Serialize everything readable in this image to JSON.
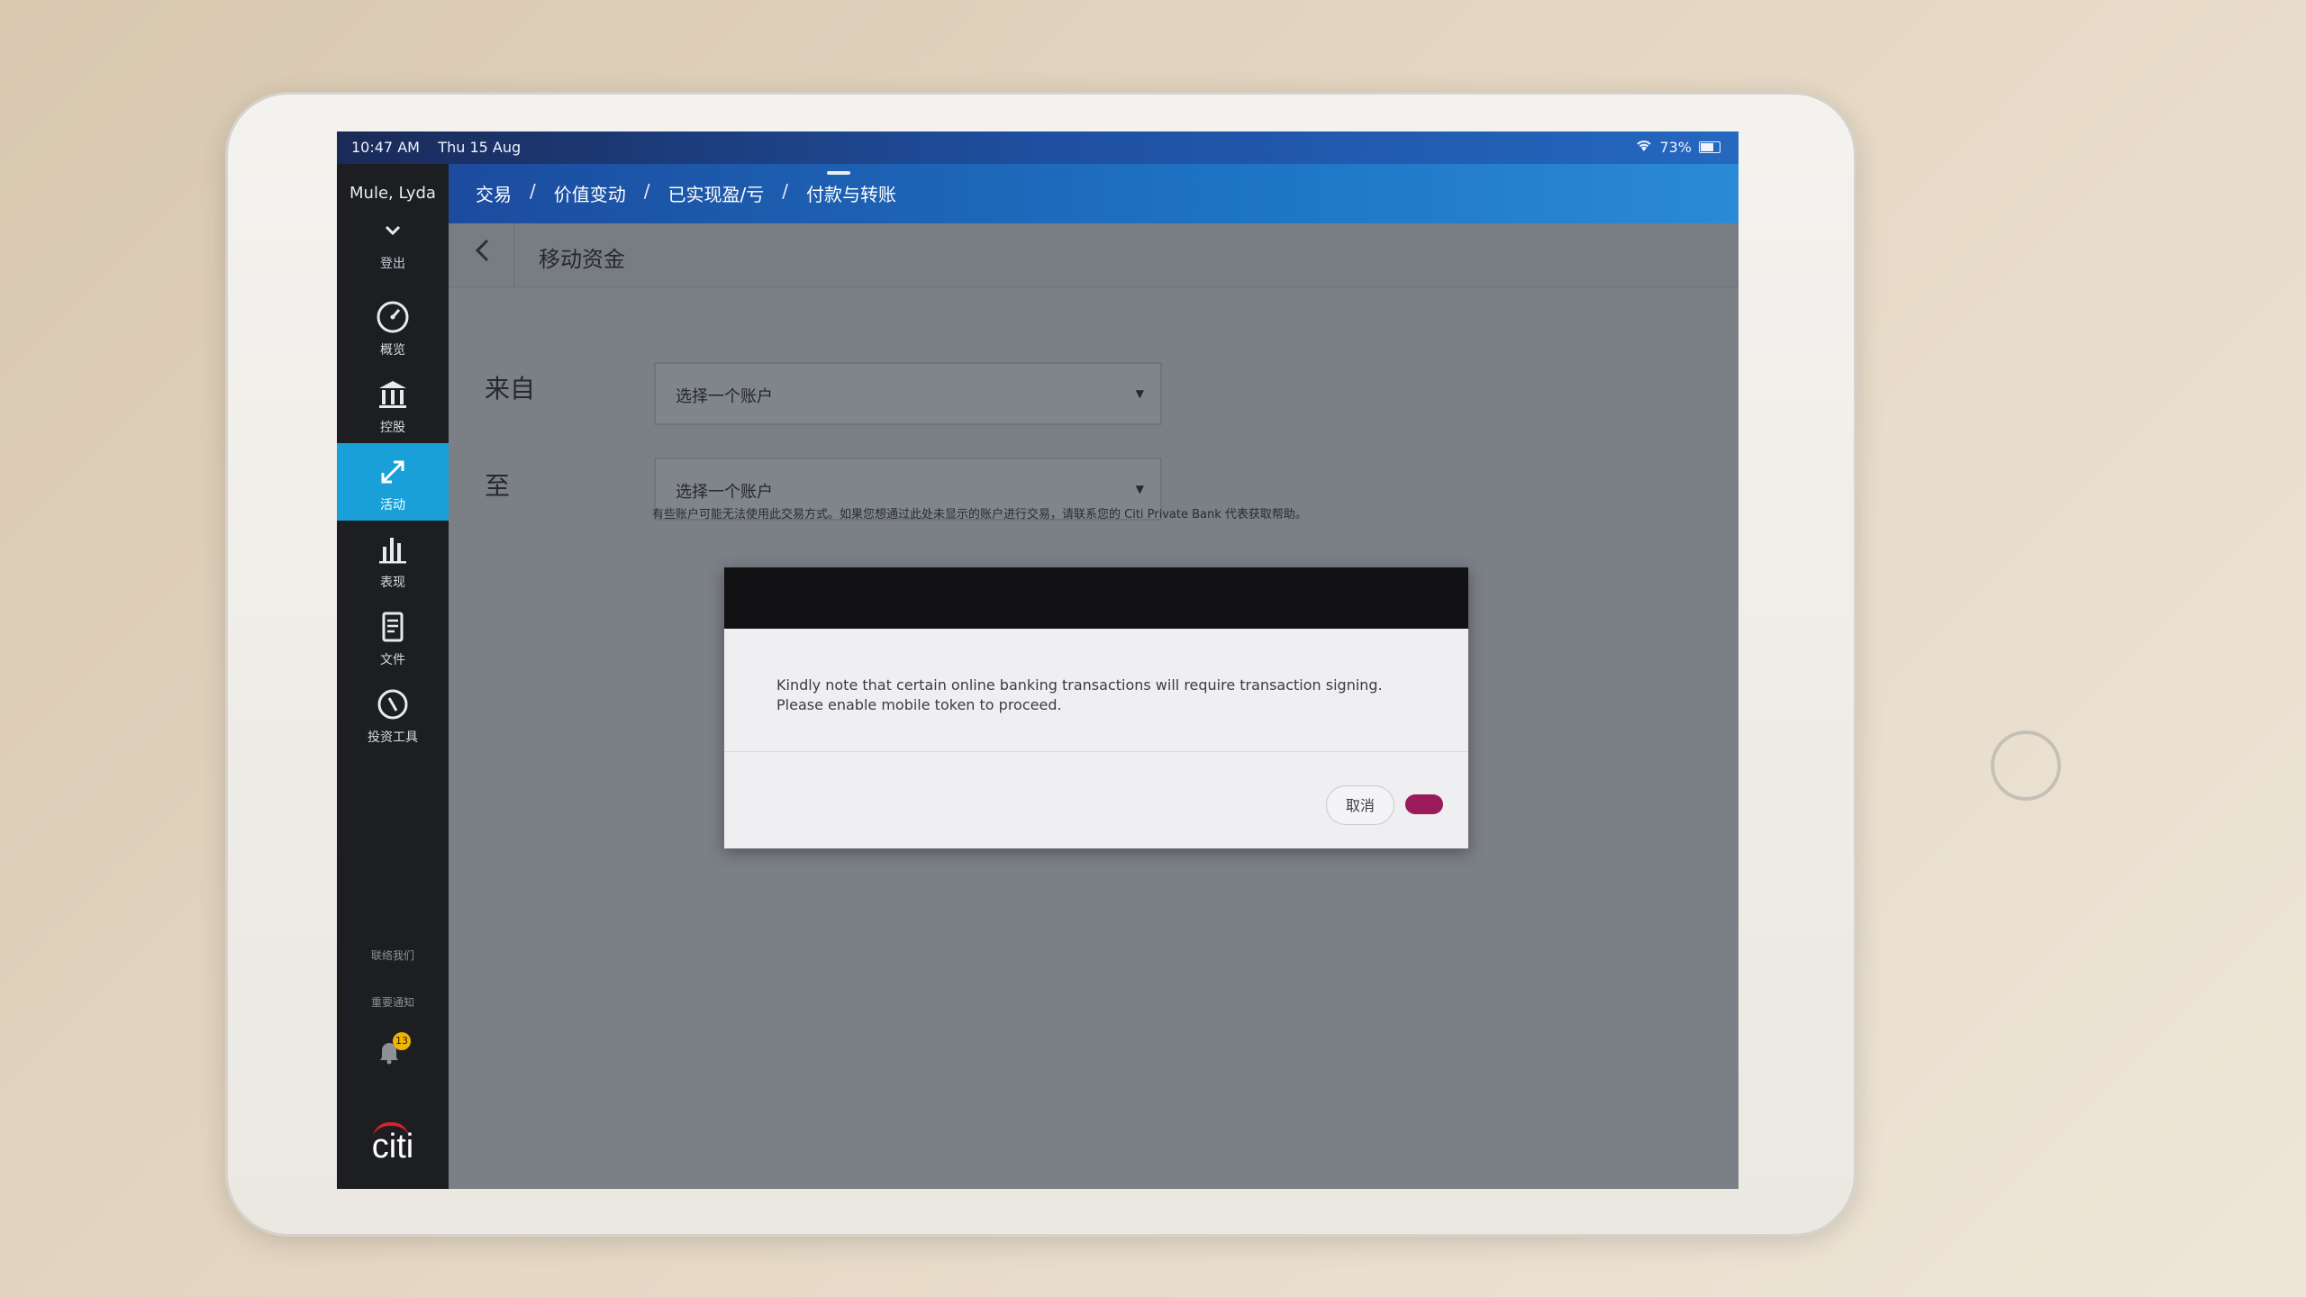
{
  "status_bar": {
    "time": "10:47 AM",
    "date": "Thu 15 Aug",
    "battery": "73%"
  },
  "sidebar": {
    "user_name": "Mule, Lyda",
    "logout_label": "登出",
    "items": [
      {
        "label": "概览",
        "icon": "gauge-icon"
      },
      {
        "label": "控股",
        "icon": "bank-icon"
      },
      {
        "label": "活动",
        "icon": "transfer-arrows-icon",
        "active": true
      },
      {
        "label": "表现",
        "icon": "bar-chart-icon"
      },
      {
        "label": "文件",
        "icon": "document-icon"
      },
      {
        "label": "投资工具",
        "icon": "compass-icon"
      }
    ],
    "contact_label": "联络我们",
    "notices_label": "重要通知",
    "notification_badge": "13",
    "logo_text": "citi"
  },
  "topnav": {
    "crumbs": [
      "交易",
      "价值变动",
      "已实现盈/亏",
      "付款与转账"
    ],
    "separator": "/"
  },
  "page": {
    "title": "移动资金",
    "from_label": "来自",
    "to_label": "至",
    "from_select": "选择一个账户",
    "to_select": "选择一个账户",
    "notice": "有些账户可能无法使用此交易方式。如果您想通过此处未显示的账户进行交易，请联系您的 Citi Private Bank 代表获取帮助。"
  },
  "dialog": {
    "line1": "Kindly note that certain online banking transactions will require transaction signing.",
    "line2": "Please enable mobile token to proceed.",
    "cancel_label": "取消"
  },
  "colors": {
    "sidebar_active": "#1aa0d8",
    "nav_blue": "#1e73c4",
    "confirm_button": "#9a1a5a",
    "citi_red": "#d6232a"
  }
}
